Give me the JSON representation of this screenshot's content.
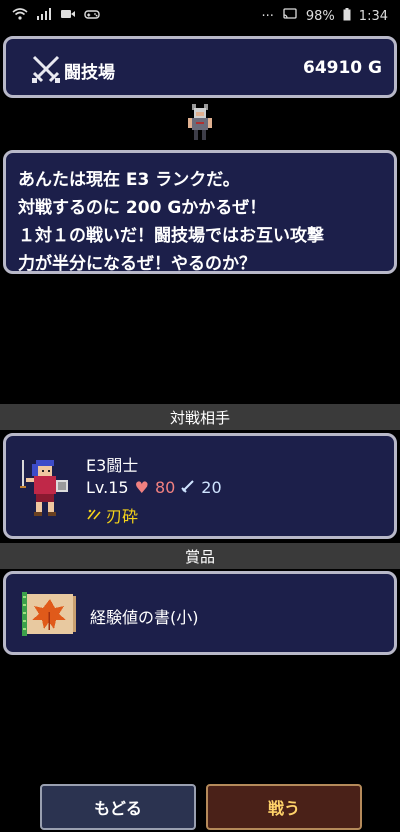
{
  "status_bar": {
    "battery": "98%",
    "time": "1:34"
  },
  "header": {
    "title": "闘技場",
    "gold": "64910 G",
    "icon": "crossed-swords-icon"
  },
  "dialog": {
    "lines": [
      "あんたは現在 E3 ランクだ。",
      "対戦するのに 200 Gかかるぜ！",
      "１対１の戦いだ！闘技場ではお互い攻撃",
      "力が半分になるぜ！やるのか？"
    ]
  },
  "opponent_section": {
    "label": "対戦相手"
  },
  "opponent": {
    "name": "E3闘士",
    "level": "Lv.15",
    "hp": "80",
    "attack": "20",
    "skill": "刃砕"
  },
  "prize_section": {
    "label": "賞品"
  },
  "prize": {
    "label": "経験値の書(小)"
  },
  "buttons": {
    "back": "もどる",
    "fight": "戦う"
  },
  "colors": {
    "panel_bg": "#1c1f4a",
    "panel_border": "#b8b8c8",
    "section_bar": "#3a3a3a",
    "skill_text": "#f4d21a",
    "fight_text": "#ffd36a"
  }
}
